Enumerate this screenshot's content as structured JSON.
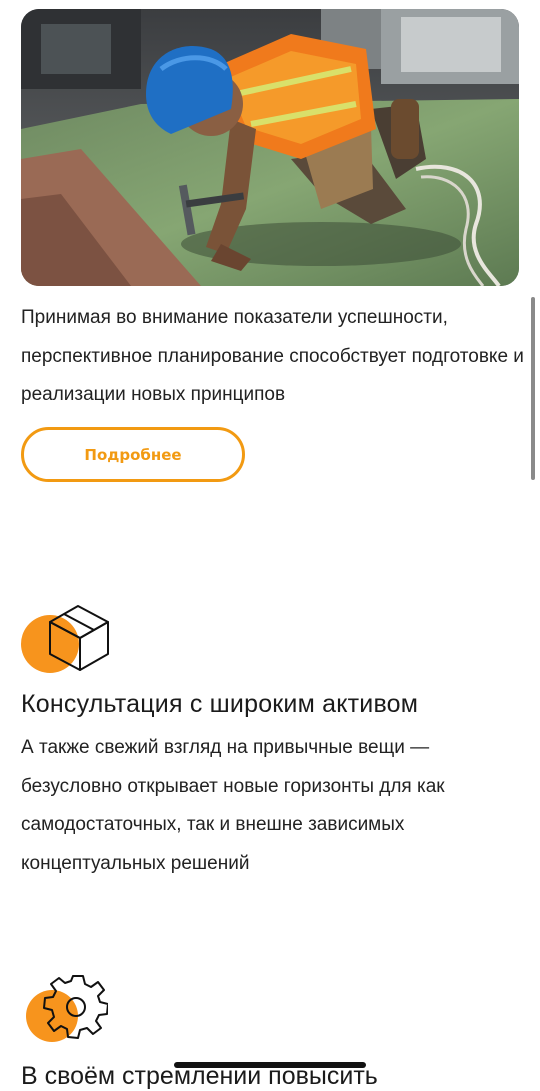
{
  "hero_image": {
    "alt": "Строитель в каске с молотком на крыше"
  },
  "service_1": {
    "description": "Принимая во внимание показатели успешности, перспективное планирование способствует подготовке и реализации новых принципов",
    "button_label": "Подробнее"
  },
  "feature_1": {
    "icon": "box-icon",
    "title": "Консультация с широким активом",
    "text": "А также свежий взгляд на привычные вещи — безусловно открывает новые горизонты для как самодостаточных, так и внешне зависимых концептуальных решений"
  },
  "feature_2": {
    "icon": "gear-icon",
    "title": "В своём стремлении повысить"
  },
  "colors": {
    "accent": "#f29a12",
    "text": "#222222",
    "background": "#ffffff"
  }
}
